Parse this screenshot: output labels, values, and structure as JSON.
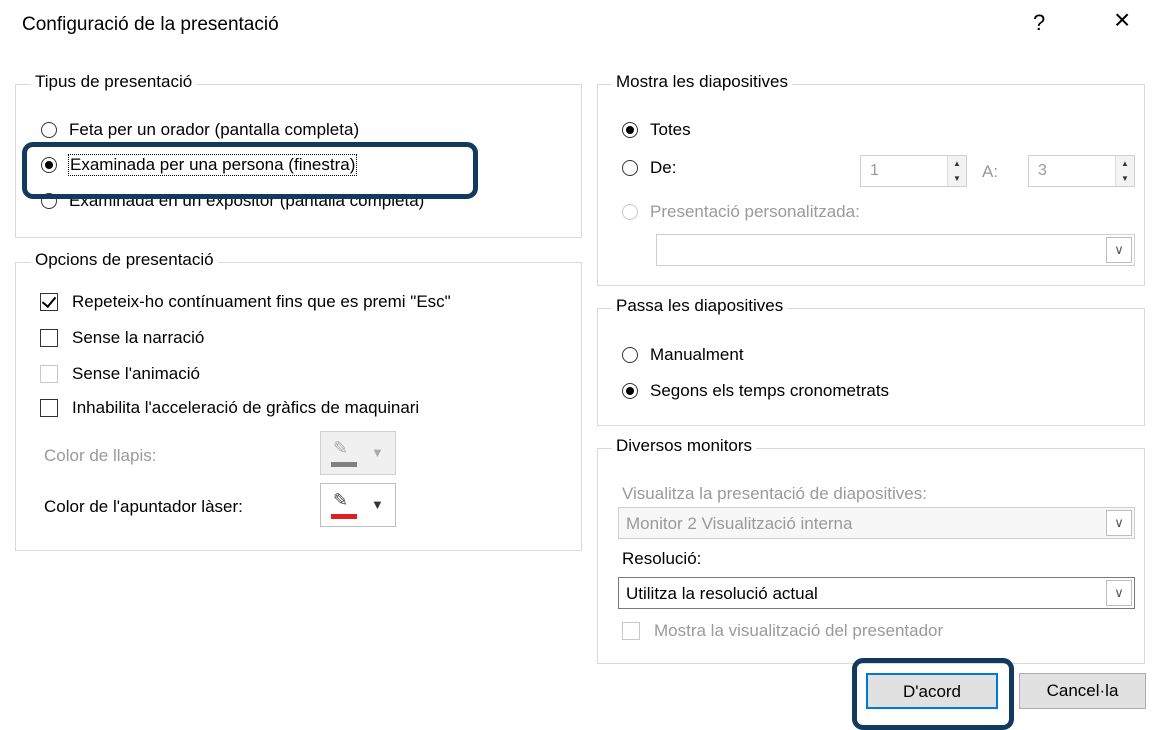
{
  "dialog": {
    "title": "Configuració de la presentació",
    "help": "?",
    "close": "×"
  },
  "show_type": {
    "legend": "Tipus de presentació",
    "options": [
      {
        "label": "Feta per un orador (pantalla completa)",
        "selected": false
      },
      {
        "label": "Examinada per una persona (finestra)",
        "selected": true
      },
      {
        "label": "Examinada en un expositor (pantalla completa)",
        "selected": false
      }
    ]
  },
  "show_options": {
    "legend": "Opcions de presentació",
    "checks": [
      {
        "label": "Repeteix-ho contínuament fins que es premi \"Esc\"",
        "checked": true,
        "enabled": true
      },
      {
        "label": "Sense la narració",
        "checked": false,
        "enabled": true
      },
      {
        "label": "Sense l'animació",
        "checked": false,
        "enabled": true
      },
      {
        "label": "Inhabilita l'acceleració de gràfics de maquinari",
        "checked": false,
        "enabled": true
      }
    ],
    "pen_color_label": "Color de llapis:",
    "laser_color_label": "Color de l'apuntador làser:",
    "pen_color": "#808080",
    "laser_color": "#e02020"
  },
  "show_slides": {
    "legend": "Mostra les diapositives",
    "all_label": "Totes",
    "from_label": "De:",
    "from_value": "1",
    "to_label": "A:",
    "to_value": "3",
    "custom_label": "Presentació personalitzada:",
    "selected": "Totes"
  },
  "advance": {
    "legend": "Passa les diapositives",
    "manual_label": "Manualment",
    "timings_label": "Segons els temps cronometrats",
    "selected": "Segons els temps cronometrats"
  },
  "monitors": {
    "legend": "Diversos monitors",
    "display_label": "Visualitza la presentació de diapositives:",
    "display_value": "Monitor 2 Visualització interna",
    "resolution_label": "Resolució:",
    "resolution_value": "Utilitza la resolució actual",
    "presenter_view_label": "Mostra la visualització del presentador"
  },
  "buttons": {
    "ok": "D'acord",
    "cancel": "Cancel·la"
  },
  "accent_color": "#0078d7",
  "highlight_color": "#123a5e"
}
